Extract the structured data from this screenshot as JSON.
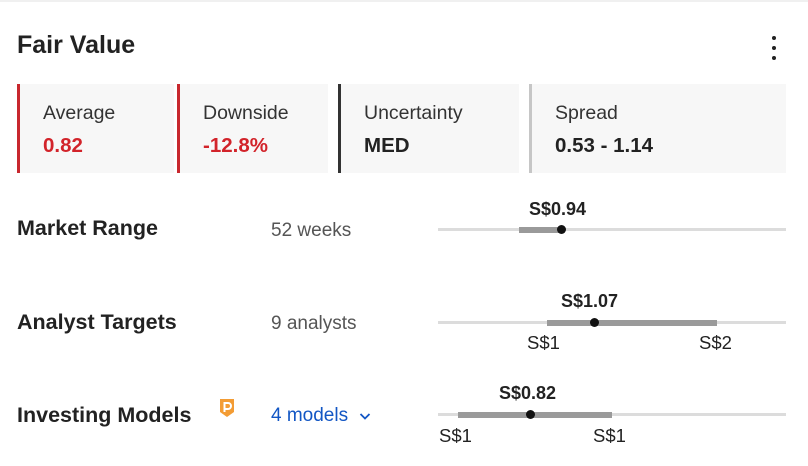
{
  "header": {
    "title": "Fair Value",
    "more_icon": "more-vertical-icon"
  },
  "cards": [
    {
      "label": "Average",
      "value": "0.82",
      "color": "#d2232a"
    },
    {
      "label": "Downside",
      "value": "-12.8%",
      "color": "#d2232a"
    },
    {
      "label": "Uncertainty",
      "value": "MED",
      "color": "#222222"
    },
    {
      "label": "Spread",
      "value": "0.53 - 1.14",
      "color": "#222222"
    }
  ],
  "rows": {
    "market_range": {
      "label": "Market Range",
      "sub": "52 weeks",
      "price": "S$0.94"
    },
    "analyst_targets": {
      "label": "Analyst Targets",
      "sub": "9 analysts",
      "price": "S$1.07",
      "low": "S$1",
      "high": "S$2"
    },
    "investing_models": {
      "label": "Investing Models",
      "sub": "4 models",
      "price": "S$0.82",
      "low": "S$1",
      "high": "S$1",
      "badge_icon": "pro-badge-icon",
      "dropdown_icon": "chevron-down-icon"
    }
  },
  "colors": {
    "accent_red": "#d2232a",
    "link_blue": "#1256c4",
    "pro_orange": "#f39c34"
  }
}
